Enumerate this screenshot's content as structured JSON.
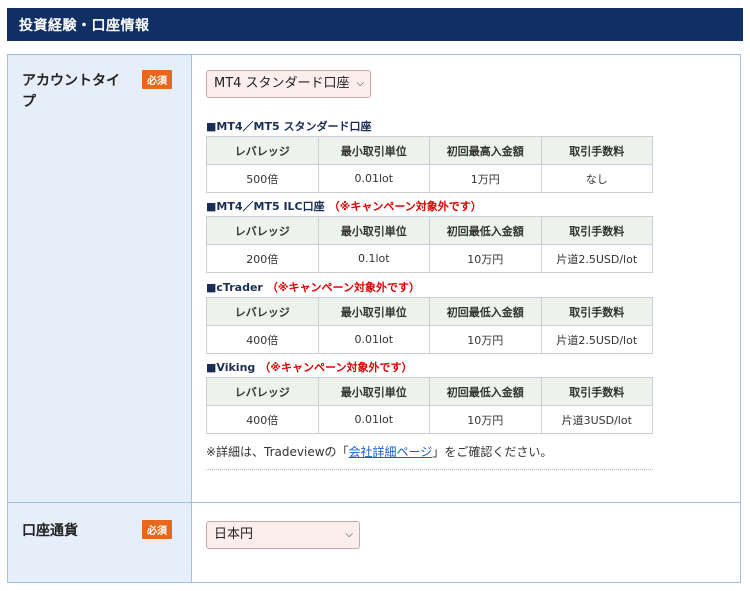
{
  "header": {
    "title": "投資経験・口座情報"
  },
  "required_label": "必須",
  "account_type": {
    "label": "アカウントタイプ",
    "selected": "MT4 スタンダード口座",
    "tables": [
      {
        "title": "MT4／MT5 スタンダード口座",
        "note": "",
        "headers": [
          "レバレッジ",
          "最小取引単位",
          "初回最高入金額",
          "取引手数料"
        ],
        "row": [
          "500倍",
          "0.01lot",
          "1万円",
          "なし"
        ]
      },
      {
        "title": "MT4／MT5 ILC口座",
        "note": "（※キャンペーン対象外です）",
        "headers": [
          "レバレッジ",
          "最小取引単位",
          "初回最低入金額",
          "取引手数料"
        ],
        "row": [
          "200倍",
          "0.1lot",
          "10万円",
          "片道2.5USD/lot"
        ]
      },
      {
        "title": "cTrader",
        "note": "（※キャンペーン対象外です）",
        "headers": [
          "レバレッジ",
          "最小取引単位",
          "初回最低入金額",
          "取引手数料"
        ],
        "row": [
          "400倍",
          "0.01lot",
          "10万円",
          "片道2.5USD/lot"
        ]
      },
      {
        "title": "Viking",
        "note": "（※キャンペーン対象外です）",
        "headers": [
          "レバレッジ",
          "最小取引単位",
          "初回最低入金額",
          "取引手数料"
        ],
        "row": [
          "400倍",
          "0.01lot",
          "10万円",
          "片道3USD/lot"
        ]
      }
    ],
    "detail_prefix": "※詳細は、Tradeviewの「",
    "detail_link": "会社詳細ページ",
    "detail_suffix": "」をご確認ください。"
  },
  "currency": {
    "label": "口座通貨",
    "selected": "日本円"
  },
  "colors": {
    "header_bg": "#102f63",
    "label_bg": "#e6eff9",
    "required_badge": "#e8671b",
    "select_bg": "#fdeeee",
    "note_red": "#e00000",
    "link": "#1a5fc8"
  }
}
